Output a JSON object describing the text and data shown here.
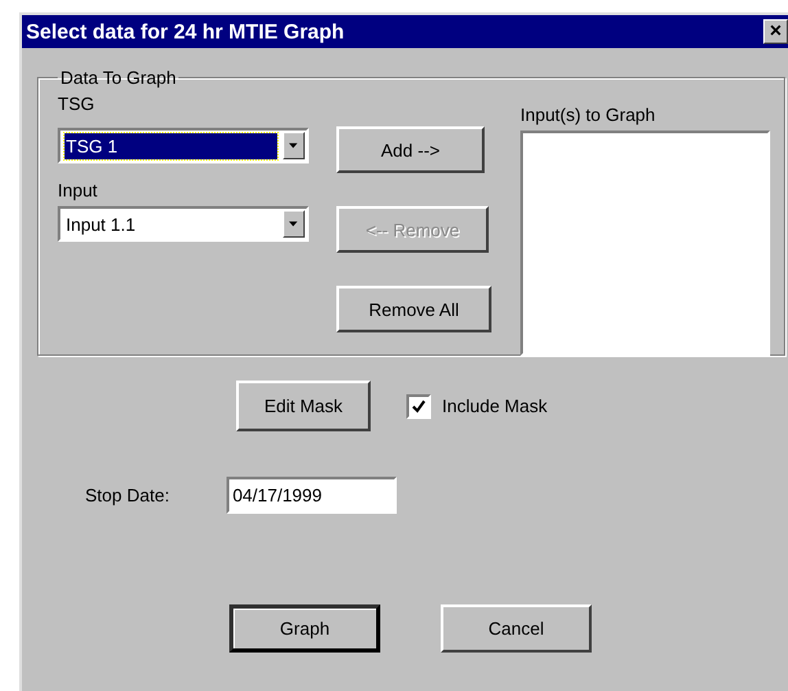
{
  "window": {
    "title": "Select data for 24 hr MTIE Graph",
    "close": "×"
  },
  "group": {
    "title": "Data To Graph",
    "tsg": {
      "label": "TSG",
      "value": "TSG 1",
      "focused": true
    },
    "input": {
      "label": "Input",
      "value": "Input 1.1",
      "focused": false
    },
    "buttons": [
      {
        "label": "Add -->",
        "disabled": false
      },
      {
        "label": "<-- Remove",
        "disabled": true
      },
      {
        "label": "Remove All",
        "disabled": false
      }
    ],
    "list": {
      "label": "Input(s) to Graph"
    }
  },
  "edit_mask": "Edit Mask",
  "include_mask": {
    "label": "Include Mask",
    "checked": true
  },
  "stop_date": {
    "label": "Stop Date:",
    "value": "04/17/1999"
  },
  "buttons": [
    {
      "label": "Graph",
      "default": true
    },
    {
      "label": "Cancel",
      "default": false
    }
  ]
}
